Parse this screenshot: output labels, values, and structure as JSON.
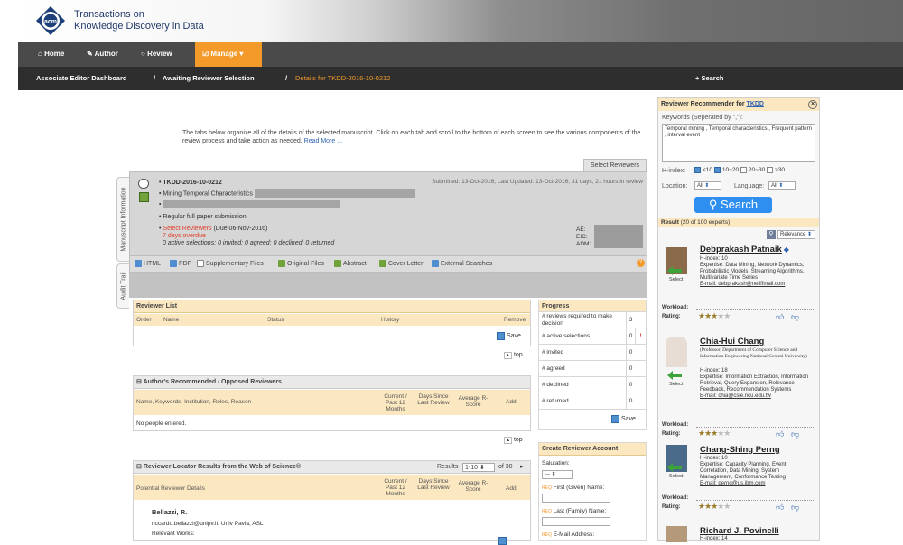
{
  "header": {
    "title_line1": "Transactions on",
    "title_line2": "Knowledge Discovery in Data"
  },
  "nav": {
    "home": "Home",
    "author": "Author",
    "review": "Review",
    "manage": "Manage"
  },
  "breadcrumb": {
    "item1": "Associate Editor Dashboard",
    "sep": "/",
    "item2": "Awaiting Reviewer Selection",
    "item3": "Details for TKDD-2016-10-0212",
    "search": "+ Search"
  },
  "intro": {
    "text": "The tabs below organize all of the details of the selected manuscript. Click on each tab and scroll to the bottom of each screen to see the various components of the review process and take action as needed.",
    "read_more": "Read More ..."
  },
  "tabs": {
    "select_reviewers": "Select Reviewers",
    "manuscript_info": "Manuscript Information",
    "audit_trail": "Audit Trail"
  },
  "manuscript": {
    "id": "TKDD-2016-10-0212",
    "title_prefix": "Mining Temporal Characteristics",
    "dates": "Submitted: 13-Oct-2016; Last Updated: 13-Oct-2016; 31 days, 21 hours in review",
    "type": "Regular full paper submission",
    "status": "Select Reviewers",
    "due": "(Due 06-Nov-2016)",
    "overdue": "7 days overdue",
    "selections": "0 active selections; 0 invited; 0 agreed; 0 declined; 0 returned",
    "ae_label": "AE:",
    "eic_label": "EIC:",
    "adm_label": "ADM:"
  },
  "toolbar": {
    "html": "HTML",
    "pdf": "PDF",
    "supp": "Supplementary Files",
    "orig": "Original Files",
    "abstract": "Abstract",
    "cover": "Cover Letter",
    "external": "External Searches"
  },
  "reviewer_list": {
    "title": "Reviewer List",
    "cols": [
      "Order",
      "Name",
      "Status",
      "History",
      "Remove"
    ],
    "save": "Save",
    "top": "top"
  },
  "progress": {
    "title": "Progress",
    "rows": [
      {
        "label": "# reviews required to make decision",
        "value": "3"
      },
      {
        "label": "# active selections",
        "value": "0",
        "warn": "!"
      },
      {
        "label": "# invited",
        "value": "0"
      },
      {
        "label": "# agreed",
        "value": "0"
      },
      {
        "label": "# declined",
        "value": "0"
      },
      {
        "label": "# returned",
        "value": "0"
      }
    ],
    "save": "Save"
  },
  "recommended": {
    "title": "Author's Recommended / Opposed Reviewers",
    "col1": "Name, Keywords, Institution, Roles, Reason",
    "col2": "Current / Past 12 Months",
    "col3": "Days Since Last Review",
    "col4": "Average R-Score",
    "col5": "Add",
    "empty": "No people entered.",
    "top": "top"
  },
  "locator": {
    "title": "Reviewer Locator Results from the Web of Science®",
    "results_label": "Results",
    "range": "1-10",
    "of": "of 30",
    "col1": "Potential Reviewer Details",
    "col2": "Current / Past 12 Months",
    "col3": "Days Since Last Review",
    "col4": "Average R-Score",
    "col5": "Add",
    "first_name": "Bellazzi, R.",
    "first_email": "riccardo.bellazzi@unipv.it; Univ Pavia, ASL",
    "first_works": "Relevant Works:"
  },
  "create_account": {
    "title": "Create Reviewer Account",
    "salutation": "Salutation:",
    "salutation_value": "---",
    "first": "First (Given) Name:",
    "last": "Last (Family) Name:",
    "email": "E-Mail Address:"
  },
  "recommender": {
    "title": "Reviewer Recommender for",
    "title_link": "TKDD",
    "keywords_label": "Keywords (Seperated by \",\"):",
    "keywords_value": "Temporal mining , Temporal characteristics , Frequent pattern , interval event",
    "hindex_label": "H-index:",
    "hopts": [
      "<10",
      "10~20",
      "20~30",
      ">30"
    ],
    "location_label": "Location:",
    "location_value": "All",
    "language_label": "Language:",
    "language_value": "All",
    "search": "Search",
    "result_label": "Result",
    "result_count": "(20 of 100 experts)",
    "sort_value": "Relevance",
    "experts": [
      {
        "name": "Debprakash Patnaik",
        "affil": "",
        "hindex": "H-index: 10",
        "expertise": "Expertise: Data Mining, Network Dynamics, Probabilistic Models, Streaming Algorithms, Multivariate Time Series",
        "email": "E-mail: debprakash@neilffmail.com",
        "workload": "Workload:",
        "rating": "Rating:",
        "stars": 3
      },
      {
        "name": "Chia-Hui Chang",
        "affil": "(Professor, Department of Computer Science and Information Engineering National Central University)",
        "hindex": "H-index: 18",
        "expertise": "Expertise: Information Extraction, Information Retrieval, Query Expansion, Relevance Feedback, Recommendation Systems",
        "email": "E-mail: chia@csie.ncu.edu.tw",
        "workload": "Workload:",
        "rating": "Rating:",
        "stars": 3
      },
      {
        "name": "Chang-Shing Perng",
        "affil": "",
        "hindex": "H-index: 10",
        "expertise": "Expertise: Capacity Planning, Event Correlation, Data Mining, System Management, Conformance Testing",
        "email": "E-mail: perng@us.ibm.com",
        "workload": "Workload:",
        "rating": "Rating:",
        "stars": 3
      },
      {
        "name": "Richard J. Povinelli",
        "affil": "",
        "hindex": "H-index: 14",
        "expertise": "",
        "email": "",
        "workload": "",
        "rating": "",
        "stars": 0
      }
    ],
    "select_label": "Select"
  },
  "colors": {
    "accent": "#f39a2b",
    "navbar": "#4a4a4a",
    "crumb": "#2e2e2e",
    "panel_head": "#fbe7c0",
    "link": "#2f64b3"
  }
}
